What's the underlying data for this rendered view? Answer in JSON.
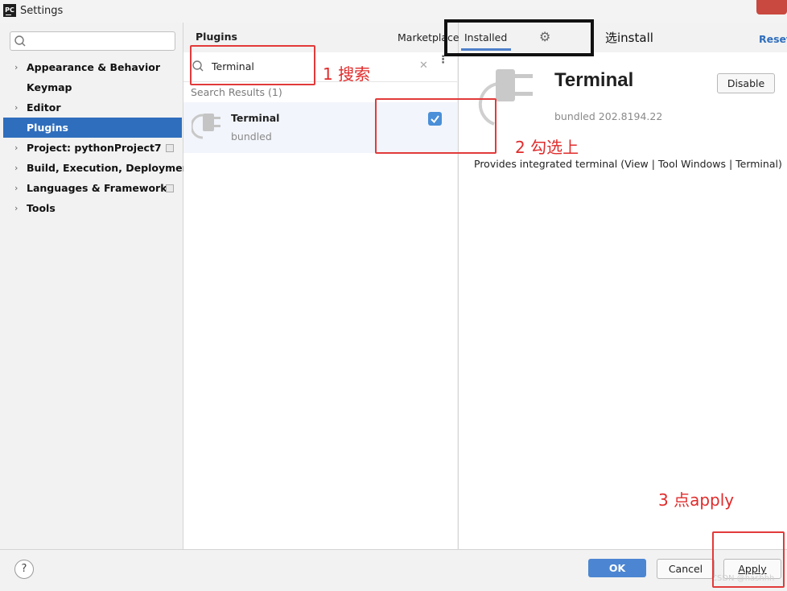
{
  "window": {
    "title": "Settings",
    "app_icon": "PC"
  },
  "sidebar": {
    "search_placeholder": "",
    "items": [
      {
        "label": "Appearance & Behavior",
        "expandable": true
      },
      {
        "label": "Keymap",
        "expandable": false
      },
      {
        "label": "Editor",
        "expandable": true
      },
      {
        "label": "Plugins",
        "expandable": false,
        "selected": true
      },
      {
        "label": "Project: pythonProject7",
        "expandable": true
      },
      {
        "label": "Build, Execution, Deployment",
        "expandable": true
      },
      {
        "label": "Languages & Frameworks",
        "expandable": true
      },
      {
        "label": "Tools",
        "expandable": true
      }
    ]
  },
  "plugins": {
    "header": "Plugins",
    "tabs": {
      "marketplace": "Marketplace",
      "installed": "Installed",
      "active": "Installed"
    },
    "reset": "Reset",
    "search_value": "Terminal",
    "results_label": "Search Results (1)",
    "results": [
      {
        "name": "Terminal",
        "sub": "bundled",
        "checked": true
      }
    ]
  },
  "detail": {
    "name": "Terminal",
    "version": "bundled 202.8194.22",
    "disable_label": "Disable",
    "description": "Provides integrated terminal (View | Tool Windows | Terminal)"
  },
  "footer": {
    "help": "?",
    "ok": "OK",
    "cancel": "Cancel",
    "apply": "Apply",
    "watermark": "CSDN @hashhh"
  },
  "annotations": {
    "step1": "1 搜索",
    "step2": "2 勾选上",
    "step3": "3 点apply",
    "installed_note": "选install"
  },
  "colors": {
    "selection": "#2f6ebd",
    "ok_button": "#4c86d2",
    "annotation_red": "#e02b2b",
    "link": "#2f6ebd"
  }
}
